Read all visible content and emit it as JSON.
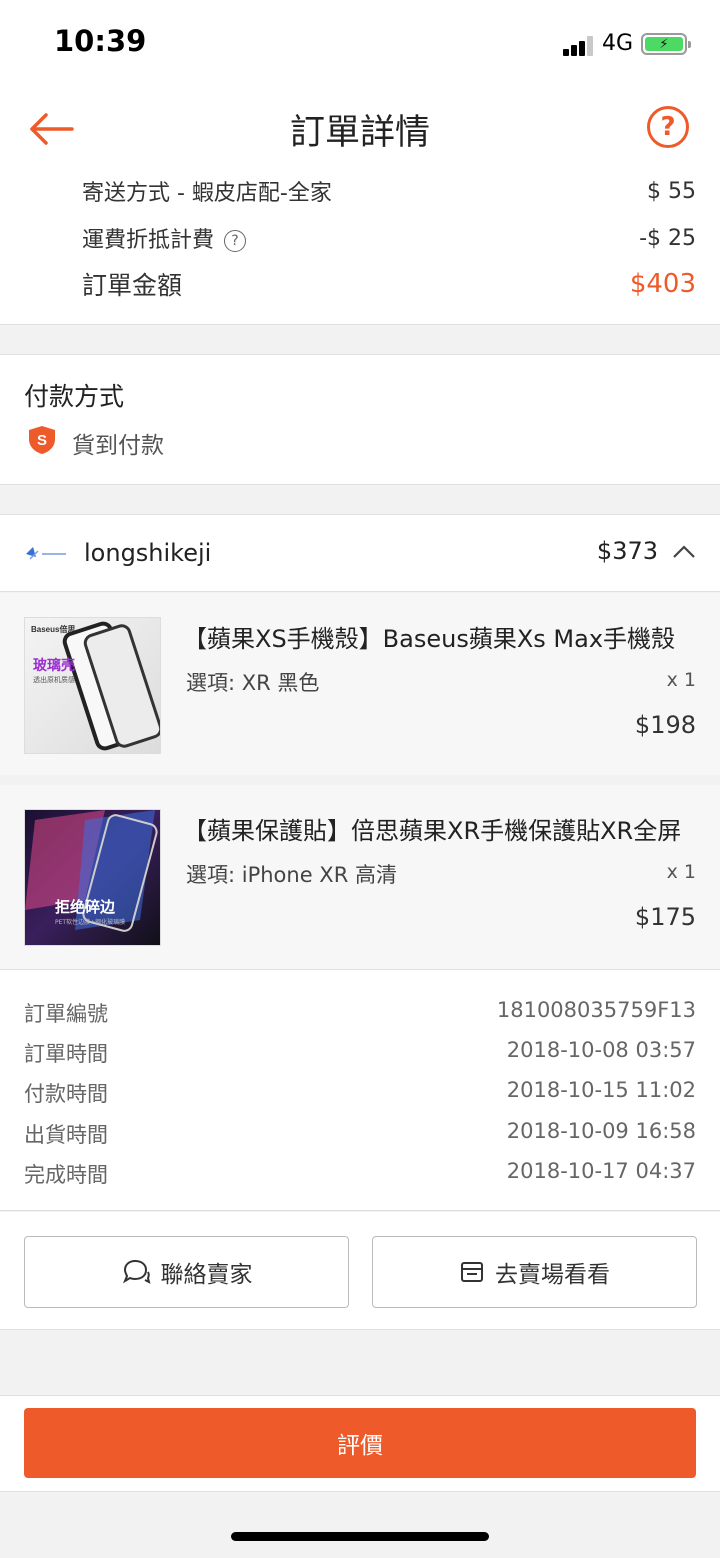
{
  "status_bar": {
    "time": "10:39",
    "network": "4G"
  },
  "nav": {
    "title": "訂單詳情",
    "help_symbol": "?"
  },
  "summary": {
    "shipping_label": "寄送方式 - 蝦皮店配-全家",
    "shipping_value": "$ 55",
    "discount_label": "運費折抵計費",
    "discount_value": "-$ 25",
    "total_label": "訂單金額",
    "total_value": "$403"
  },
  "payment": {
    "title": "付款方式",
    "method": "貨到付款"
  },
  "shop": {
    "name": "longshikeji",
    "total": "$373",
    "products": [
      {
        "name": "【蘋果XS手機殼】Baseus蘋果Xs Max手機殼",
        "option": "選項: XR 黑色",
        "qty": "x 1",
        "price": "$198",
        "img_brand": "Baseus倍思",
        "img_caption": "玻璃壳",
        "img_sub": "透出原机质感"
      },
      {
        "name": "【蘋果保護貼】倍思蘋果XR手機保護貼XR全屏",
        "option": "選項: iPhone XR 高清",
        "qty": "x 1",
        "price": "$175",
        "img_caption": "拒绝碎边",
        "img_sub": "PET软性边膜+钢化玻璃膜"
      }
    ]
  },
  "order_info": [
    {
      "label": "訂單編號",
      "value": "181008035759F13"
    },
    {
      "label": "訂單時間",
      "value": "2018-10-08 03:57"
    },
    {
      "label": "付款時間",
      "value": "2018-10-15 11:02"
    },
    {
      "label": "出貨時間",
      "value": "2018-10-09 16:58"
    },
    {
      "label": "完成時間",
      "value": "2018-10-17 04:37"
    }
  ],
  "actions": {
    "contact_seller": "聯絡賣家",
    "visit_shop": "去賣場看看"
  },
  "rate_button": "評價",
  "colors": {
    "accent": "#ee5a2a",
    "battery": "#4cd964"
  }
}
